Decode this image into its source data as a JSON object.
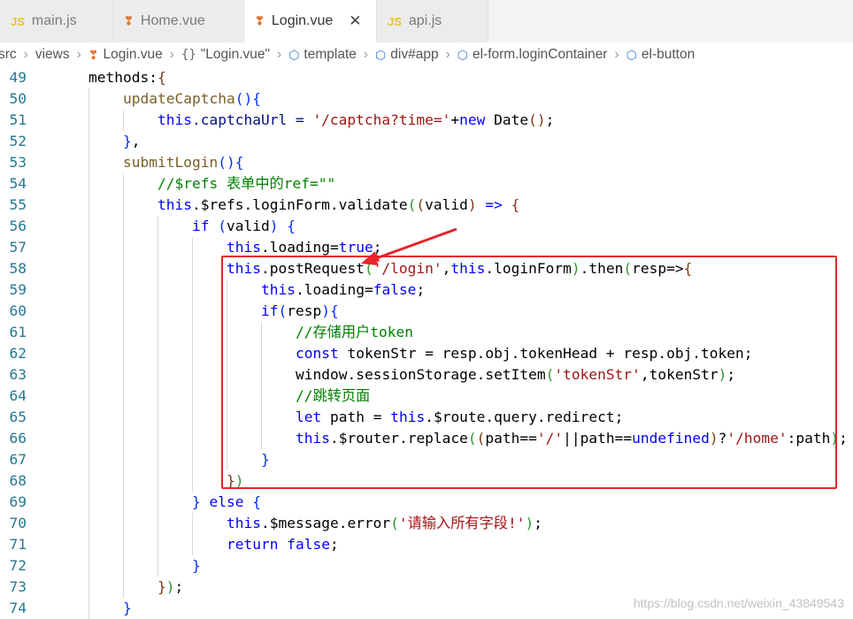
{
  "tabs": [
    {
      "icon": "js-file-icon",
      "glyph": "JS",
      "label": "main.js",
      "active": false
    },
    {
      "icon": "vue-file-icon",
      "glyph": "❣",
      "label": "Home.vue",
      "active": false
    },
    {
      "icon": "vue-file-icon",
      "glyph": "❣",
      "label": "Login.vue",
      "active": true,
      "close": "✕"
    },
    {
      "icon": "js-file-icon",
      "glyph": "JS",
      "label": "api.js",
      "active": false
    }
  ],
  "breadcrumb": [
    {
      "label": "src",
      "icon": ""
    },
    {
      "label": "views",
      "icon": ""
    },
    {
      "label": "Login.vue",
      "icon": "vue-file-icon"
    },
    {
      "label": "\"Login.vue\"",
      "icon": "braces-icon"
    },
    {
      "label": "template",
      "icon": "cube-icon"
    },
    {
      "label": "div#app",
      "icon": "cube-icon"
    },
    {
      "label": "el-form.loginContainer",
      "icon": "cube-icon"
    },
    {
      "label": "el-button",
      "icon": "cube-icon"
    }
  ],
  "code_lines": [
    {
      "n": "49",
      "indent": 1,
      "segs": [
        [
          "methods:",
          ""
        ],
        [
          "{",
          "b3"
        ]
      ]
    },
    {
      "n": "50",
      "indent": 2,
      "segs": [
        [
          "updateCaptcha",
          "fn"
        ],
        [
          "()",
          "b1"
        ],
        [
          "{",
          "b1"
        ]
      ]
    },
    {
      "n": "51",
      "indent": 3,
      "segs": [
        [
          "this",
          "kw"
        ],
        [
          ".captchaUrl = ",
          "pr"
        ],
        [
          "'/captcha?time='",
          "str"
        ],
        [
          "+",
          ""
        ],
        [
          "new",
          "kw"
        ],
        [
          " Date",
          ""
        ],
        [
          "()",
          "b3"
        ],
        [
          ";",
          ""
        ]
      ]
    },
    {
      "n": "52",
      "indent": 2,
      "segs": [
        [
          "}",
          "b1"
        ],
        [
          ",",
          ""
        ]
      ]
    },
    {
      "n": "53",
      "indent": 2,
      "segs": [
        [
          "submitLogin",
          "fn"
        ],
        [
          "()",
          "b1"
        ],
        [
          "{",
          "b1"
        ]
      ]
    },
    {
      "n": "54",
      "indent": 3,
      "segs": [
        [
          "//$refs 表单中的ref=\"\"",
          "cm"
        ]
      ]
    },
    {
      "n": "55",
      "indent": 3,
      "segs": [
        [
          "this",
          "kw"
        ],
        [
          ".$refs.loginForm.validate",
          ""
        ],
        [
          "(",
          "b2"
        ],
        [
          "(",
          "b3"
        ],
        [
          "valid",
          ""
        ],
        [
          ")",
          "b3"
        ],
        [
          " => ",
          "kw"
        ],
        [
          "{",
          "b3"
        ]
      ]
    },
    {
      "n": "56",
      "indent": 4,
      "segs": [
        [
          "if",
          "kw"
        ],
        [
          " ",
          ""
        ],
        [
          "(",
          "b1"
        ],
        [
          "valid",
          ""
        ],
        [
          ")",
          "b1"
        ],
        [
          " ",
          ""
        ],
        [
          "{",
          "b1"
        ]
      ]
    },
    {
      "n": "57",
      "indent": 5,
      "segs": [
        [
          "this",
          "kw"
        ],
        [
          ".loading=",
          ""
        ],
        [
          "true",
          "kw"
        ],
        [
          ";",
          ""
        ]
      ]
    },
    {
      "n": "58",
      "indent": 5,
      "segs": [
        [
          "this",
          "kw"
        ],
        [
          ".postRequest",
          ""
        ],
        [
          "(",
          "b2"
        ],
        [
          "'/login'",
          "str"
        ],
        [
          ",",
          ""
        ],
        [
          "this",
          "kw"
        ],
        [
          ".loginForm",
          ""
        ],
        [
          ")",
          "b2"
        ],
        [
          ".then",
          ""
        ],
        [
          "(",
          "b2"
        ],
        [
          "resp=>",
          ""
        ],
        [
          "{",
          "b3"
        ]
      ]
    },
    {
      "n": "59",
      "indent": 6,
      "segs": [
        [
          "this",
          "kw"
        ],
        [
          ".loading=",
          ""
        ],
        [
          "false",
          "kw"
        ],
        [
          ";",
          ""
        ]
      ]
    },
    {
      "n": "60",
      "indent": 6,
      "segs": [
        [
          "if",
          "kw"
        ],
        [
          "(",
          "b1"
        ],
        [
          "resp",
          ""
        ],
        [
          ")",
          "b1"
        ],
        [
          "{",
          "b1"
        ]
      ]
    },
    {
      "n": "61",
      "indent": 7,
      "segs": [
        [
          "//存储用户token",
          "cm"
        ]
      ]
    },
    {
      "n": "62",
      "indent": 7,
      "segs": [
        [
          "const",
          "kw"
        ],
        [
          " tokenStr = resp.obj.tokenHead + resp.obj.token;",
          ""
        ]
      ]
    },
    {
      "n": "63",
      "indent": 7,
      "segs": [
        [
          "window.sessionStorage.setItem",
          ""
        ],
        [
          "(",
          "b2"
        ],
        [
          "'tokenStr'",
          "str"
        ],
        [
          ",tokenStr",
          ""
        ],
        [
          ")",
          "b2"
        ],
        [
          ";",
          ""
        ]
      ]
    },
    {
      "n": "64",
      "indent": 7,
      "segs": [
        [
          "//跳转页面",
          "cm"
        ]
      ]
    },
    {
      "n": "65",
      "indent": 7,
      "segs": [
        [
          "let",
          "kw"
        ],
        [
          " path = ",
          ""
        ],
        [
          "this",
          "kw"
        ],
        [
          ".$route.query.redirect;",
          ""
        ]
      ]
    },
    {
      "n": "66",
      "indent": 7,
      "segs": [
        [
          "this",
          "kw"
        ],
        [
          ".$router.replace",
          ""
        ],
        [
          "(",
          "b2"
        ],
        [
          "(",
          "b3"
        ],
        [
          "path==",
          ""
        ],
        [
          "'/'",
          "str"
        ],
        [
          "||",
          ""
        ],
        [
          "path==",
          ""
        ],
        [
          "undefined",
          "kw"
        ],
        [
          ")",
          "b3"
        ],
        [
          "?",
          ""
        ],
        [
          "'/home'",
          "str"
        ],
        [
          ":path",
          ""
        ],
        [
          ")",
          "b2"
        ],
        [
          ";",
          ""
        ]
      ]
    },
    {
      "n": "67",
      "indent": 6,
      "segs": [
        [
          "}",
          "b1"
        ]
      ]
    },
    {
      "n": "68",
      "indent": 5,
      "segs": [
        [
          "}",
          "b3"
        ],
        [
          ")",
          "b2"
        ]
      ]
    },
    {
      "n": "69",
      "indent": 4,
      "segs": [
        [
          "}",
          "b1"
        ],
        [
          " ",
          ""
        ],
        [
          "else",
          "kw"
        ],
        [
          " ",
          ""
        ],
        [
          "{",
          "b1"
        ]
      ]
    },
    {
      "n": "70",
      "indent": 5,
      "segs": [
        [
          "this",
          "kw"
        ],
        [
          ".$message.error",
          ""
        ],
        [
          "(",
          "b2"
        ],
        [
          "'请输入所有字段!'",
          "str"
        ],
        [
          ")",
          "b2"
        ],
        [
          ";",
          ""
        ]
      ]
    },
    {
      "n": "71",
      "indent": 5,
      "segs": [
        [
          "return",
          "kw"
        ],
        [
          " ",
          ""
        ],
        [
          "false",
          "kw"
        ],
        [
          ";",
          ""
        ]
      ]
    },
    {
      "n": "72",
      "indent": 4,
      "segs": [
        [
          "}",
          "b1"
        ]
      ]
    },
    {
      "n": "73",
      "indent": 3,
      "segs": [
        [
          "}",
          "b3"
        ],
        [
          ")",
          "b2"
        ],
        [
          ";",
          ""
        ]
      ]
    },
    {
      "n": "74",
      "indent": 2,
      "segs": [
        [
          "}",
          "b1"
        ]
      ]
    }
  ],
  "watermark": "https://blog.csdn.net/weixin_43849543",
  "colors": {
    "annotation": "#e8232a",
    "keyword": "#0000ff",
    "string": "#a31515",
    "comment": "#008000",
    "line_number": "#237893"
  }
}
